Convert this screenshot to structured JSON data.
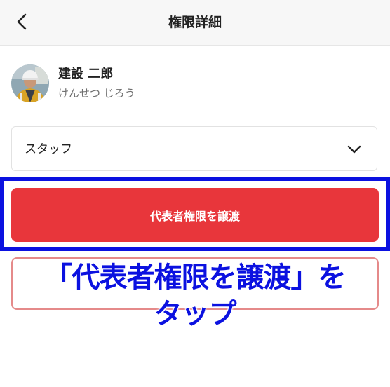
{
  "header": {
    "title": "権限詳細",
    "back_icon": "chevron-left-icon"
  },
  "user": {
    "name": "建設 二郎",
    "kana": "けんせつ じろう",
    "avatar_icon": "user-avatar-photo"
  },
  "role_select": {
    "value": "スタッフ",
    "chevron_icon": "chevron-down-icon"
  },
  "transfer_button": {
    "label": "代表者権限を譲渡"
  },
  "annotation": {
    "line1": "「代表者権限を譲渡」を",
    "line2": "タップ"
  },
  "colors": {
    "button_red": "#e8363b",
    "highlight_blue": "#0b11e0",
    "callout_border": "#e58a8a",
    "header_bg": "#f7f7f7"
  }
}
